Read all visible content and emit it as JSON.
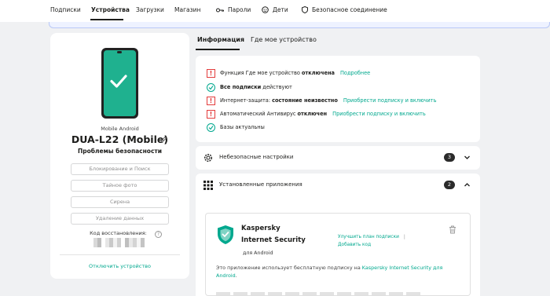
{
  "nav": {
    "items": [
      {
        "label": "Подписки"
      },
      {
        "label": "Устройства"
      },
      {
        "label": "Загрузки"
      },
      {
        "label": "Магазин"
      },
      {
        "label": "Пароли",
        "icon": "key-icon"
      },
      {
        "label": "Дети",
        "icon": "kids-icon"
      },
      {
        "label": "Безопасное соединение",
        "icon": "vpn-shield-icon"
      }
    ],
    "active": "Устройства"
  },
  "device": {
    "type": "Mobile Android",
    "name": "DUA-L22 (Mobile)",
    "status": "Проблемы безопасности",
    "actions": [
      {
        "label": "Блокирование и Поиск"
      },
      {
        "label": "Тайное фото"
      },
      {
        "label": "Сирена"
      },
      {
        "label": "Удаление данных"
      }
    ],
    "recovery_label": "Код восстановления:",
    "disconnect_label": "Отключить устройство"
  },
  "tabs": [
    {
      "label": "Информация"
    },
    {
      "label": "Где мое устройство"
    }
  ],
  "status_items": [
    {
      "kind": "warn",
      "pre": "Функция Где мое устройство ",
      "bold": "отключена",
      "post": "",
      "link": "Подробнее"
    },
    {
      "kind": "ok",
      "pre": "",
      "bold": "Все подписки",
      "post": " действуют",
      "link": ""
    },
    {
      "kind": "warn",
      "pre": "Интернет-защита: ",
      "bold": "состояние неизвестно",
      "post": "",
      "link": "Приобрести подписку и включить"
    },
    {
      "kind": "warn",
      "pre": "Автоматический Антивирус ",
      "bold": "отключен",
      "post": "",
      "link": "Приобрести подписку и включить"
    },
    {
      "kind": "ok",
      "pre": "Базы актуальны",
      "bold": "",
      "post": "",
      "link": ""
    }
  ],
  "sections": [
    {
      "label": "Небезопасные настройки",
      "count": "3",
      "expanded": false,
      "icon": "gear-icon"
    },
    {
      "label": "Установленные приложения",
      "count": "2",
      "expanded": true,
      "icon": "apps-grid-icon"
    }
  ],
  "app": {
    "name_line1": "Kaspersky",
    "name_line2": "Internet Security",
    "platform": "для Android",
    "link_plan": "Улучшить план подписки",
    "link_code": "Добавить код",
    "desc_pre": "Это приложение использует бесплатную подписку на ",
    "desc_link": "Kaspersky Internet Security для Android",
    "desc_post": "."
  },
  "colors": {
    "accent": "#00a88e",
    "warning": "#e33b3b",
    "dark": "#1d1d1b"
  }
}
